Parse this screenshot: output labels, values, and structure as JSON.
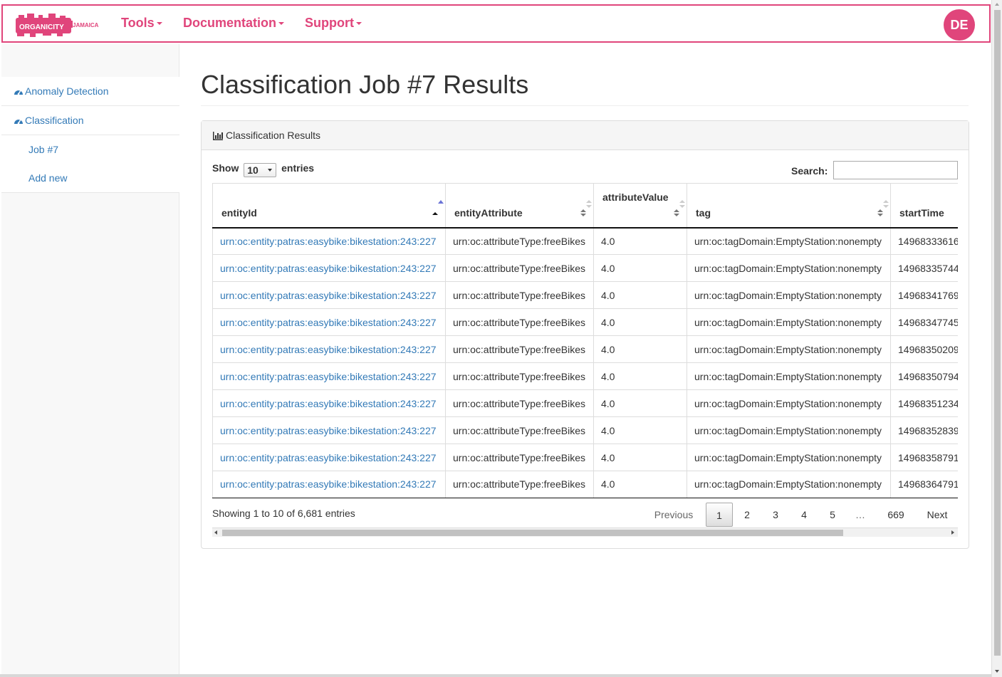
{
  "navbar": {
    "logo_text": "ORGANICITY",
    "logo_sub": "JAMAICA",
    "items": [
      {
        "label": "Tools"
      },
      {
        "label": "Documentation"
      },
      {
        "label": "Support"
      }
    ],
    "avatar_initials": "DE",
    "brand_color": "#e0457b"
  },
  "sidebar": {
    "items": [
      {
        "label": "Anomaly Detection",
        "icon": "dashboard-icon"
      },
      {
        "label": "Classification",
        "icon": "dashboard-icon"
      }
    ],
    "subitems": [
      {
        "label": "Job #7"
      },
      {
        "label": "Add new"
      }
    ]
  },
  "page": {
    "title": "Classification Job #7 Results"
  },
  "panel": {
    "heading": "Classification Results",
    "length": {
      "show": "Show",
      "value": "10",
      "entries": "entries"
    },
    "search_label": "Search:",
    "search_value": "",
    "columns": [
      "entityId",
      "entityAttribute",
      "attributeValue",
      "tag",
      "startTime"
    ],
    "rows": [
      [
        "urn:oc:entity:patras:easybike:bikestation:243:227",
        "urn:oc:attributeType:freeBikes",
        "4.0",
        "urn:oc:tagDomain:EmptyStation:nonempty",
        "14968333616"
      ],
      [
        "urn:oc:entity:patras:easybike:bikestation:243:227",
        "urn:oc:attributeType:freeBikes",
        "4.0",
        "urn:oc:tagDomain:EmptyStation:nonempty",
        "14968335744"
      ],
      [
        "urn:oc:entity:patras:easybike:bikestation:243:227",
        "urn:oc:attributeType:freeBikes",
        "4.0",
        "urn:oc:tagDomain:EmptyStation:nonempty",
        "14968341769"
      ],
      [
        "urn:oc:entity:patras:easybike:bikestation:243:227",
        "urn:oc:attributeType:freeBikes",
        "4.0",
        "urn:oc:tagDomain:EmptyStation:nonempty",
        "14968347745"
      ],
      [
        "urn:oc:entity:patras:easybike:bikestation:243:227",
        "urn:oc:attributeType:freeBikes",
        "4.0",
        "urn:oc:tagDomain:EmptyStation:nonempty",
        "14968350209"
      ],
      [
        "urn:oc:entity:patras:easybike:bikestation:243:227",
        "urn:oc:attributeType:freeBikes",
        "4.0",
        "urn:oc:tagDomain:EmptyStation:nonempty",
        "14968350794"
      ],
      [
        "urn:oc:entity:patras:easybike:bikestation:243:227",
        "urn:oc:attributeType:freeBikes",
        "4.0",
        "urn:oc:tagDomain:EmptyStation:nonempty",
        "14968351234"
      ],
      [
        "urn:oc:entity:patras:easybike:bikestation:243:227",
        "urn:oc:attributeType:freeBikes",
        "4.0",
        "urn:oc:tagDomain:EmptyStation:nonempty",
        "14968352839"
      ],
      [
        "urn:oc:entity:patras:easybike:bikestation:243:227",
        "urn:oc:attributeType:freeBikes",
        "4.0",
        "urn:oc:tagDomain:EmptyStation:nonempty",
        "14968358791"
      ],
      [
        "urn:oc:entity:patras:easybike:bikestation:243:227",
        "urn:oc:attributeType:freeBikes",
        "4.0",
        "urn:oc:tagDomain:EmptyStation:nonempty",
        "14968364791"
      ]
    ],
    "info": "Showing 1 to 10 of 6,681 entries",
    "pagination": {
      "previous": "Previous",
      "pages": [
        "1",
        "2",
        "3",
        "4",
        "5",
        "…",
        "669"
      ],
      "active": "1",
      "next": "Next"
    }
  }
}
